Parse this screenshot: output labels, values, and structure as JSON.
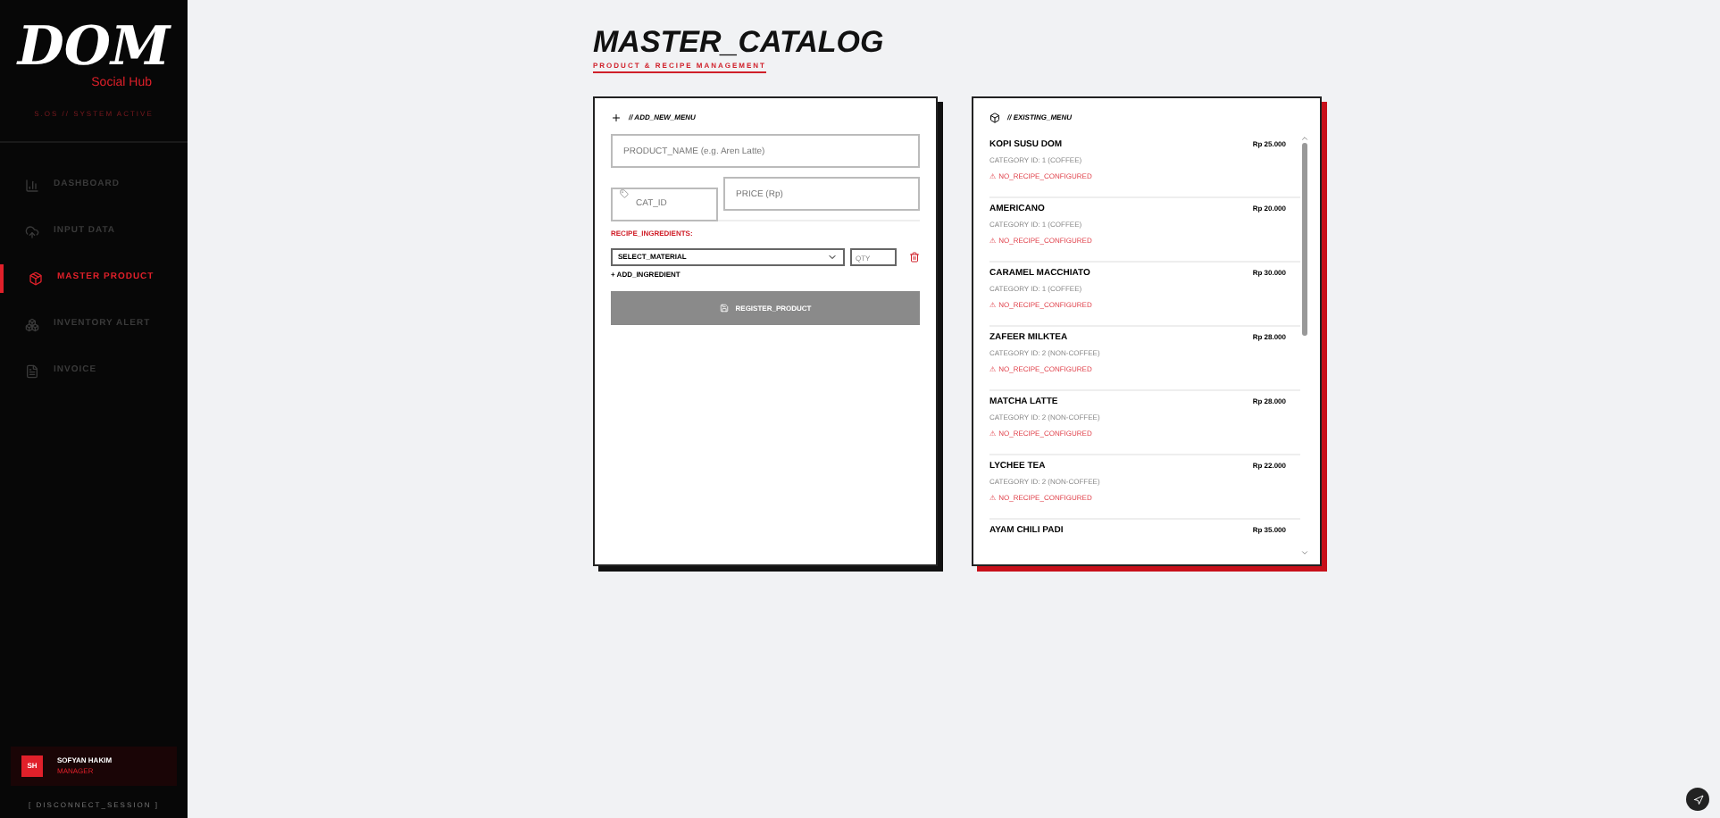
{
  "sidebar": {
    "logo": "DOM",
    "logo_sub": "Social Hub",
    "status": "S.OS // SYSTEM ACTIVE",
    "items": [
      {
        "label": "DASHBOARD",
        "selected": false
      },
      {
        "label": "INPUT DATA",
        "selected": false
      },
      {
        "label": "MASTER PRODUCT",
        "selected": true
      },
      {
        "label": "INVENTORY ALERT",
        "selected": false
      },
      {
        "label": "INVOICE",
        "selected": false
      }
    ],
    "user": {
      "initials": "SH",
      "name": "SOFYAN HAKIM",
      "role": "MANAGER"
    },
    "logout": "[ DISCONNECT_SESSION ]"
  },
  "header": {
    "title": "MASTER_CATALOG",
    "subtitle": "PRODUCT & RECIPE MANAGEMENT"
  },
  "form": {
    "title": "// ADD_NEW_MENU",
    "name_placeholder": "PRODUCT_NAME (e.g. Aren Latte)",
    "cat_placeholder": "CAT_ID",
    "price_placeholder": "PRICE (Rp)",
    "recipe_label": "RECIPE_INGREDIENTS:",
    "material_value": "SELECT_MATERIAL",
    "qty_placeholder": "QTY",
    "add_ingredient": "+ ADD_INGREDIENT",
    "submit": "REGISTER_PRODUCT"
  },
  "menu": {
    "title": "// EXISTING_MENU",
    "items": [
      {
        "name": "KOPI SUSU DOM",
        "category": "CATEGORY ID: 1 (COFFEE)",
        "price": "Rp 25.000",
        "warning": "⚠ NO_RECIPE_CONFIGURED"
      },
      {
        "name": "AMERICANO",
        "category": "CATEGORY ID: 1 (COFFEE)",
        "price": "Rp 20.000",
        "warning": "⚠ NO_RECIPE_CONFIGURED"
      },
      {
        "name": "CARAMEL MACCHIATO",
        "category": "CATEGORY ID: 1 (COFFEE)",
        "price": "Rp 30.000",
        "warning": "⚠ NO_RECIPE_CONFIGURED"
      },
      {
        "name": "ZAFEER MILKTEA",
        "category": "CATEGORY ID: 2 (NON-COFFEE)",
        "price": "Rp 28.000",
        "warning": "⚠ NO_RECIPE_CONFIGURED"
      },
      {
        "name": "MATCHA LATTE",
        "category": "CATEGORY ID: 2 (NON-COFFEE)",
        "price": "Rp 28.000",
        "warning": "⚠ NO_RECIPE_CONFIGURED"
      },
      {
        "name": "LYCHEE TEA",
        "category": "CATEGORY ID: 2 (NON-COFFEE)",
        "price": "Rp 22.000",
        "warning": "⚠ NO_RECIPE_CONFIGURED"
      },
      {
        "name": "AYAM CHILI PADI",
        "price": "Rp 35.000"
      }
    ]
  }
}
